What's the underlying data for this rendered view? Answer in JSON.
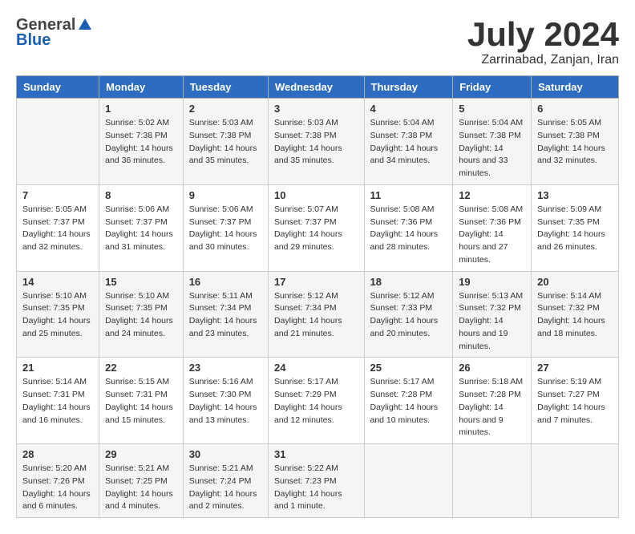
{
  "header": {
    "logo_general": "General",
    "logo_blue": "Blue",
    "month_title": "July 2024",
    "location": "Zarrinabad, Zanjan, Iran"
  },
  "weekdays": [
    "Sunday",
    "Monday",
    "Tuesday",
    "Wednesday",
    "Thursday",
    "Friday",
    "Saturday"
  ],
  "weeks": [
    [
      {
        "day": "",
        "sunrise": "",
        "sunset": "",
        "daylight": ""
      },
      {
        "day": "1",
        "sunrise": "5:02 AM",
        "sunset": "7:38 PM",
        "daylight": "14 hours and 36 minutes."
      },
      {
        "day": "2",
        "sunrise": "5:03 AM",
        "sunset": "7:38 PM",
        "daylight": "14 hours and 35 minutes."
      },
      {
        "day": "3",
        "sunrise": "5:03 AM",
        "sunset": "7:38 PM",
        "daylight": "14 hours and 35 minutes."
      },
      {
        "day": "4",
        "sunrise": "5:04 AM",
        "sunset": "7:38 PM",
        "daylight": "14 hours and 34 minutes."
      },
      {
        "day": "5",
        "sunrise": "5:04 AM",
        "sunset": "7:38 PM",
        "daylight": "14 hours and 33 minutes."
      },
      {
        "day": "6",
        "sunrise": "5:05 AM",
        "sunset": "7:38 PM",
        "daylight": "14 hours and 32 minutes."
      }
    ],
    [
      {
        "day": "7",
        "sunrise": "5:05 AM",
        "sunset": "7:37 PM",
        "daylight": "14 hours and 32 minutes."
      },
      {
        "day": "8",
        "sunrise": "5:06 AM",
        "sunset": "7:37 PM",
        "daylight": "14 hours and 31 minutes."
      },
      {
        "day": "9",
        "sunrise": "5:06 AM",
        "sunset": "7:37 PM",
        "daylight": "14 hours and 30 minutes."
      },
      {
        "day": "10",
        "sunrise": "5:07 AM",
        "sunset": "7:37 PM",
        "daylight": "14 hours and 29 minutes."
      },
      {
        "day": "11",
        "sunrise": "5:08 AM",
        "sunset": "7:36 PM",
        "daylight": "14 hours and 28 minutes."
      },
      {
        "day": "12",
        "sunrise": "5:08 AM",
        "sunset": "7:36 PM",
        "daylight": "14 hours and 27 minutes."
      },
      {
        "day": "13",
        "sunrise": "5:09 AM",
        "sunset": "7:35 PM",
        "daylight": "14 hours and 26 minutes."
      }
    ],
    [
      {
        "day": "14",
        "sunrise": "5:10 AM",
        "sunset": "7:35 PM",
        "daylight": "14 hours and 25 minutes."
      },
      {
        "day": "15",
        "sunrise": "5:10 AM",
        "sunset": "7:35 PM",
        "daylight": "14 hours and 24 minutes."
      },
      {
        "day": "16",
        "sunrise": "5:11 AM",
        "sunset": "7:34 PM",
        "daylight": "14 hours and 23 minutes."
      },
      {
        "day": "17",
        "sunrise": "5:12 AM",
        "sunset": "7:34 PM",
        "daylight": "14 hours and 21 minutes."
      },
      {
        "day": "18",
        "sunrise": "5:12 AM",
        "sunset": "7:33 PM",
        "daylight": "14 hours and 20 minutes."
      },
      {
        "day": "19",
        "sunrise": "5:13 AM",
        "sunset": "7:32 PM",
        "daylight": "14 hours and 19 minutes."
      },
      {
        "day": "20",
        "sunrise": "5:14 AM",
        "sunset": "7:32 PM",
        "daylight": "14 hours and 18 minutes."
      }
    ],
    [
      {
        "day": "21",
        "sunrise": "5:14 AM",
        "sunset": "7:31 PM",
        "daylight": "14 hours and 16 minutes."
      },
      {
        "day": "22",
        "sunrise": "5:15 AM",
        "sunset": "7:31 PM",
        "daylight": "14 hours and 15 minutes."
      },
      {
        "day": "23",
        "sunrise": "5:16 AM",
        "sunset": "7:30 PM",
        "daylight": "14 hours and 13 minutes."
      },
      {
        "day": "24",
        "sunrise": "5:17 AM",
        "sunset": "7:29 PM",
        "daylight": "14 hours and 12 minutes."
      },
      {
        "day": "25",
        "sunrise": "5:17 AM",
        "sunset": "7:28 PM",
        "daylight": "14 hours and 10 minutes."
      },
      {
        "day": "26",
        "sunrise": "5:18 AM",
        "sunset": "7:28 PM",
        "daylight": "14 hours and 9 minutes."
      },
      {
        "day": "27",
        "sunrise": "5:19 AM",
        "sunset": "7:27 PM",
        "daylight": "14 hours and 7 minutes."
      }
    ],
    [
      {
        "day": "28",
        "sunrise": "5:20 AM",
        "sunset": "7:26 PM",
        "daylight": "14 hours and 6 minutes."
      },
      {
        "day": "29",
        "sunrise": "5:21 AM",
        "sunset": "7:25 PM",
        "daylight": "14 hours and 4 minutes."
      },
      {
        "day": "30",
        "sunrise": "5:21 AM",
        "sunset": "7:24 PM",
        "daylight": "14 hours and 2 minutes."
      },
      {
        "day": "31",
        "sunrise": "5:22 AM",
        "sunset": "7:23 PM",
        "daylight": "14 hours and 1 minute."
      },
      {
        "day": "",
        "sunrise": "",
        "sunset": "",
        "daylight": ""
      },
      {
        "day": "",
        "sunrise": "",
        "sunset": "",
        "daylight": ""
      },
      {
        "day": "",
        "sunrise": "",
        "sunset": "",
        "daylight": ""
      }
    ]
  ]
}
